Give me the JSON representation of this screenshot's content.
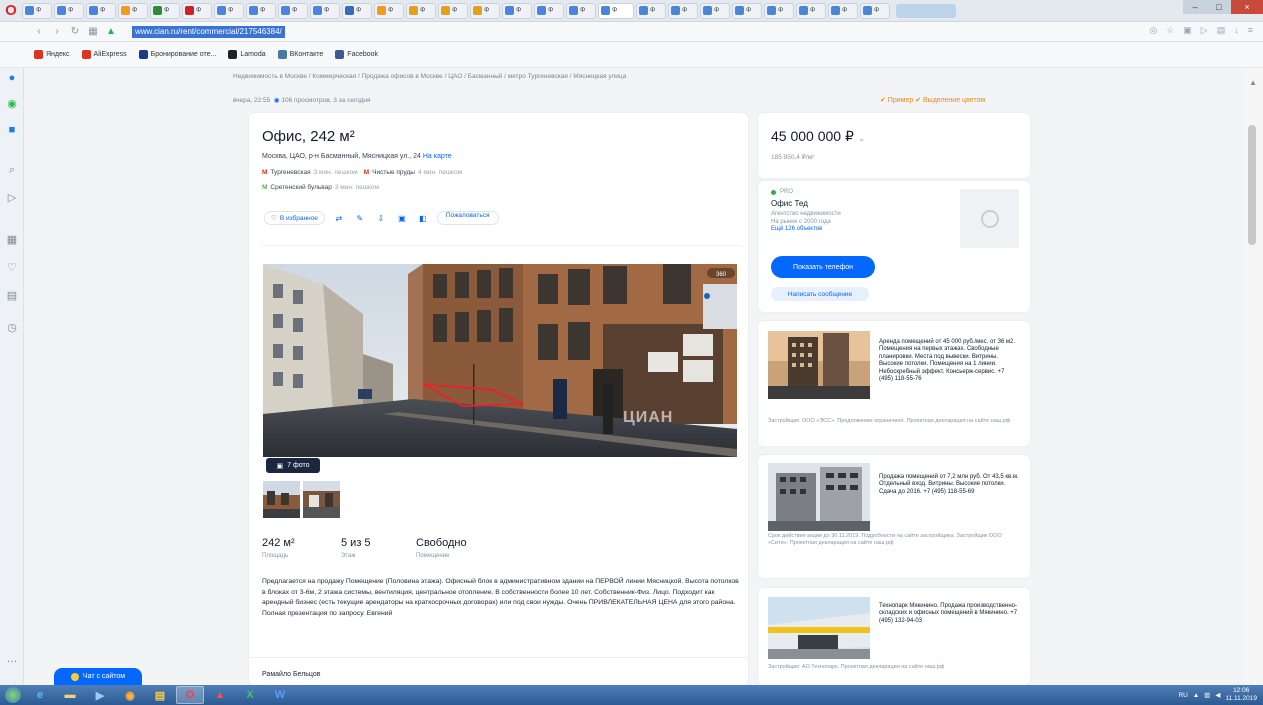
{
  "browser": {
    "tabs": [
      {
        "label": "Ф",
        "color": "#4a86d8"
      },
      {
        "label": "Ф",
        "color": "#4a86d8"
      },
      {
        "label": "Ф",
        "color": "#4a86d8"
      },
      {
        "label": "Ф",
        "color": "#f39a20"
      },
      {
        "label": "Ф",
        "color": "#2f8d3a"
      },
      {
        "label": "Ф",
        "color": "#d0202a"
      },
      {
        "label": "Ф",
        "color": "#4a86d8"
      },
      {
        "label": "Ф",
        "color": "#4a86d8"
      },
      {
        "label": "Ф",
        "color": "#4a86d8"
      },
      {
        "label": "Ф",
        "color": "#4a86d8"
      },
      {
        "label": "Ф",
        "color": "#3a6bb8"
      },
      {
        "label": "Ф",
        "color": "#f39a20"
      },
      {
        "label": "Ф",
        "color": "#e2a21c"
      },
      {
        "label": "Ф",
        "color": "#e2a21c"
      },
      {
        "label": "Ф",
        "color": "#e2a21c"
      },
      {
        "label": "Ф",
        "color": "#4a86d8"
      },
      {
        "label": "Ф",
        "color": "#4a86d8"
      },
      {
        "label": "Ф",
        "color": "#4a86d8"
      },
      {
        "label": "Ф",
        "color": "#4a86d8"
      },
      {
        "label": "Ф",
        "color": "#4a86d8"
      },
      {
        "label": "Ф",
        "color": "#4a86d8"
      },
      {
        "label": "Ф",
        "color": "#4a86d8"
      },
      {
        "label": "Ф",
        "color": "#4a86d8"
      },
      {
        "label": "Ф",
        "color": "#4a86d8"
      },
      {
        "label": "Ф",
        "color": "#4a86d8"
      },
      {
        "label": "Ф",
        "color": "#4a86d8"
      },
      {
        "label": "Ф",
        "color": "#4a86d8"
      }
    ],
    "url": "www.cian.ru/rent/commercial/217546384/",
    "bookmarks": [
      {
        "label": "Яндекс",
        "color": "#e2311c"
      },
      {
        "label": "AliExpress",
        "color": "#e2311c"
      },
      {
        "label": "Бронирование оте...",
        "color": "#1c3a8c"
      },
      {
        "label": "Lamoda",
        "color": "#222222"
      },
      {
        "label": "ВКонтакте",
        "color": "#4a76a8"
      },
      {
        "label": "Facebook",
        "color": "#3b5998"
      }
    ]
  },
  "page": {
    "breadcrumb": "Недвижимость в Москве / Коммерческая / Продажа офисов в Москве / ЦАО / Басманный / метро Тургеневская / Мясницкая улица",
    "meta": {
      "date": "вчера, 22:55",
      "views": "106 просмотров, 3 за сегодня"
    },
    "top_links": "✔ Пример   ✔ Выделение цветом",
    "title": "Офис, 242 м²",
    "address": "Москва, ЦАО, р-н Басманный, Мясницкая ул., 24",
    "address_link": "На карте",
    "metro": [
      {
        "line": "red",
        "name": "Тургеневская",
        "note": "3 мин. пешком"
      },
      {
        "line": "red",
        "name": "Чистые пруды",
        "note": "4 мин. пешком"
      },
      {
        "line": "green",
        "name": "Сретенский бульвар",
        "note": "3 мин. пешком"
      }
    ],
    "actions": {
      "favorite": "В избранное",
      "complain": "Пожаловаться"
    },
    "photo_count": "7 фото",
    "watermark": "ЦИАН",
    "stats": [
      {
        "value": "242 м²",
        "label": "Площадь"
      },
      {
        "value": "5 из 5",
        "label": "Этаж"
      },
      {
        "value": "Свободно",
        "label": "Помещение"
      }
    ],
    "description": "Предлагается на продажу Помещение (Половина этажа). Офисный блок в административном здании на ПЕРВОЙ линии Мясницкой. Высота потолков в блоках от 3-6м, 2 этажа системы, вентиляция, центральное отопление. В собственности более 10 лет. Собственник-Физ. Лицо. Подходит как арендный бизнес (есть текущие арендаторы на краткосрочных договорах) или под свои нужды. Очень ПРИВЛЕКАТЕЛЬНАЯ ЦЕНА для этого района. Полная презентация по запросу. Евгений",
    "next_section": "Рамайло Бельцов"
  },
  "sidebar": {
    "price": "45 000 000 ₽",
    "price_sub": "185 950,4 ₽/м²",
    "agent": {
      "status": "PRO",
      "name": "Офис Тед",
      "info": "Агентство недвижимости",
      "info2": "На рынке с 2000 года",
      "link": "Ещё 126 объектов",
      "show_phone": "Показать телефон",
      "write": "Написать сообщение"
    },
    "ads": [
      {
        "text": "Аренда помещений от 45 000 руб./мес. от 36 м2. Помещения на первых этажах. Свободные планировки. Места под вывески. Витрины. Высокие потолки. Помещения на 1 линии. Небоскребный эффект. Консьерж-сервис. +7 (495) 118-55-76",
        "foot": "Застройщик: ООО «ЭСС». Предложение ограничено. Проектная декларация на сайте наш.рф"
      },
      {
        "text": "Продажа помещений от 7,2 млн руб. От 43,5 кв.м. Отдельный вход. Витрины. Высокие потолки. Сдача до 2016. +7 (495) 118-55-69",
        "foot": "Срок действия акции до 30.11.2019. Подробности на сайте застройщика. Застройщик ООО «Сити». Проектная декларация на сайте наш.рф"
      },
      {
        "text": "Технопарк Мякинино. Продажа производственно-складских и офисных помещений в Мякинино. +7 (495) 132-94-03",
        "foot": "Застройщик: АО Технопарк. Проектная декларация на сайте наш.рф"
      }
    ]
  },
  "chat": {
    "label": "Чат с сайтом"
  },
  "taskbar": {
    "time": "12:06",
    "date": "11.11.2019",
    "lang": "RU"
  }
}
